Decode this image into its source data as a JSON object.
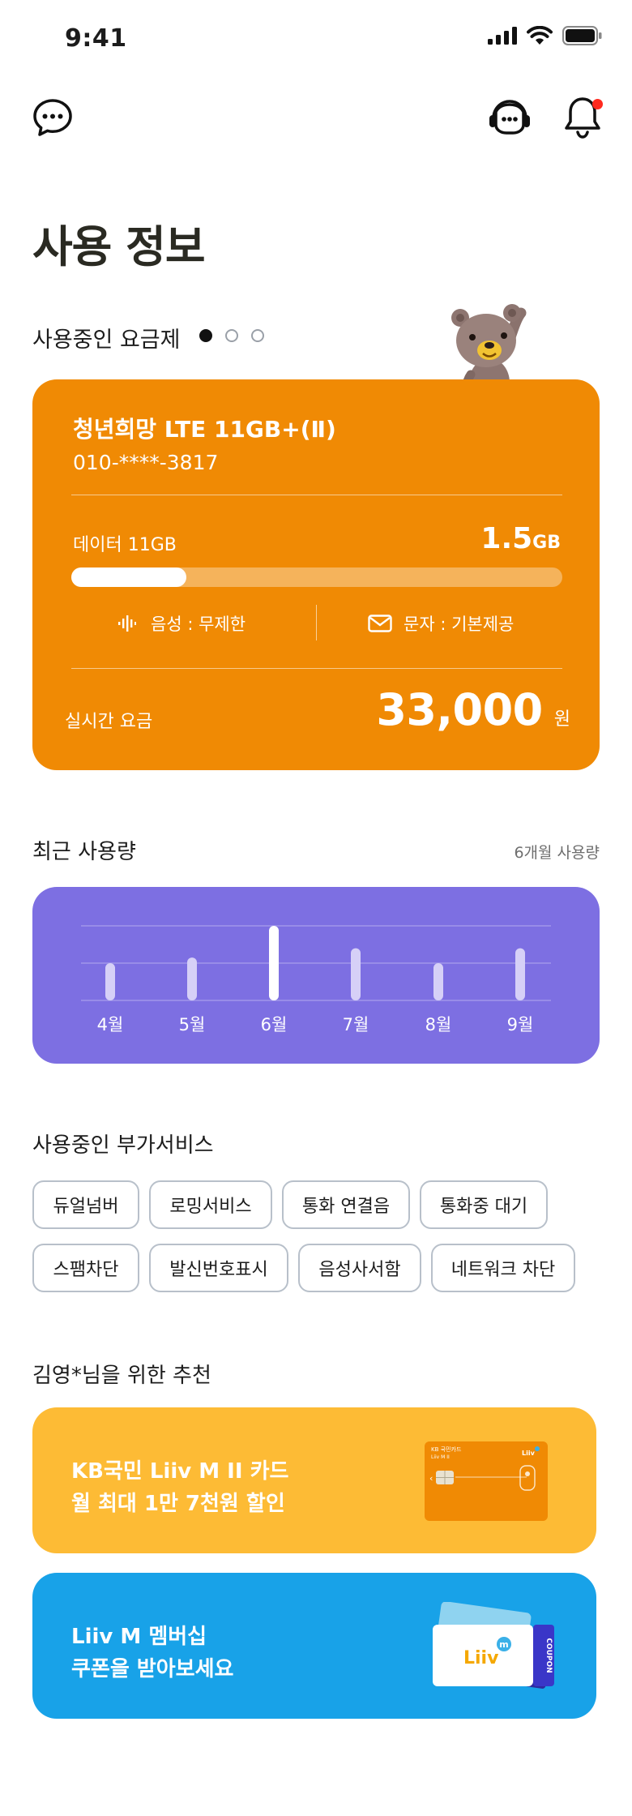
{
  "status": {
    "time": "9:41"
  },
  "icons": {
    "chat": "chat-bubble-icon",
    "support": "headset-icon",
    "bell": "bell-icon"
  },
  "title": "사용 정보",
  "plan": {
    "header": "사용중인 요금제",
    "pages": 3,
    "active_page": 1,
    "name": "청년희망 LTE 11GB+(Ⅱ)",
    "number": "010-****-3817",
    "data_label": "데이터  11GB",
    "data_value": "1.5",
    "data_unit": "GB",
    "data_used_fraction": 0.234,
    "voice": "음성 : 무제한",
    "sms": "문자 : 기본제공",
    "realtime_label": "실시간 요금",
    "realtime_price": "33,000",
    "currency": "원",
    "color": "#f08a04"
  },
  "recent": {
    "title": "최근 사용량",
    "period": "6개월 사용량",
    "color": "#7d6fe2"
  },
  "chart_data": {
    "type": "bar",
    "categories": [
      "4월",
      "5월",
      "6월",
      "7월",
      "8월",
      "9월"
    ],
    "values": [
      1.0,
      1.15,
      2.0,
      1.4,
      1.0,
      1.4
    ],
    "ylim": [
      0,
      2.0
    ],
    "grid": true,
    "highlight_index": 2
  },
  "addons": {
    "title": "사용중인 부가서비스",
    "items": [
      "듀얼넘버",
      "로밍서비스",
      "통화 연결음",
      "통화중 대기",
      "스팸차단",
      "발신번호표시",
      "음성사서함",
      "네트워크 차단"
    ]
  },
  "recommend": {
    "title": "김영*님을 위한 추천",
    "cards": [
      {
        "line1": "KB국민 Liiv M II 카드",
        "line2": "월 최대 1만 7천원 할인",
        "color": "#fdbb35",
        "card_text_1": "KB 국민카드",
        "card_text_2": "Liiv M II",
        "card_brand": "Liiv"
      },
      {
        "line1": "Liiv M 멤버십",
        "line2": "쿠폰을 받아보세요",
        "color": "#18a2e8",
        "coupon_brand": "Liiv",
        "coupon_label": "COUPON"
      }
    ]
  }
}
